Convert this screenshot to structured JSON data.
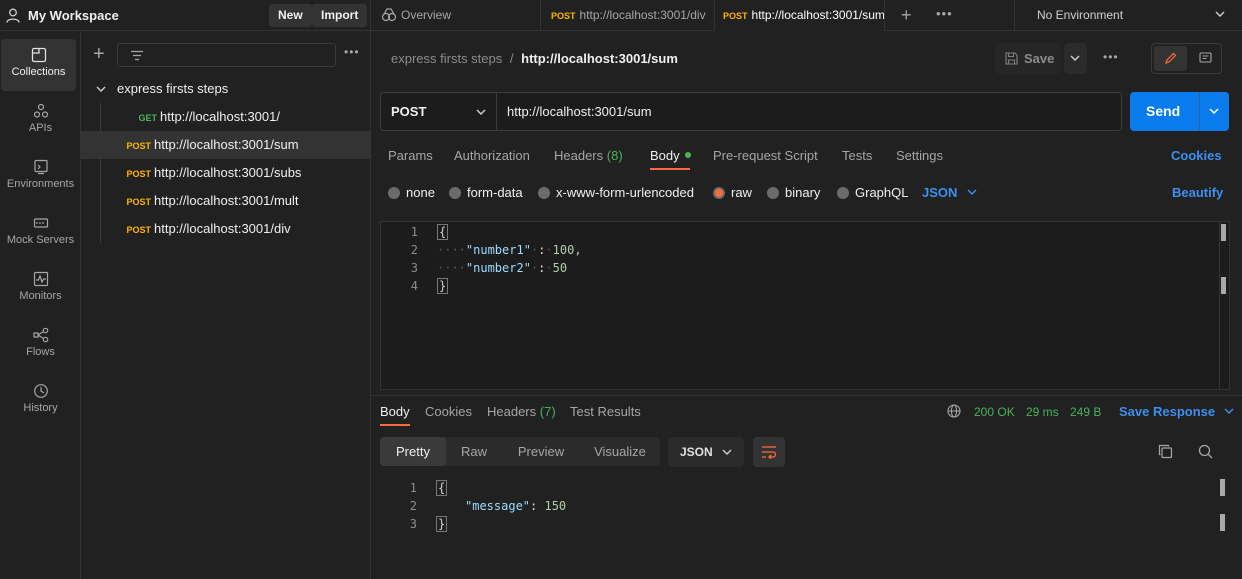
{
  "workspace": {
    "title": "My Workspace",
    "new_label": "New",
    "import_label": "Import"
  },
  "tabs": [
    {
      "label": "Overview"
    },
    {
      "method": "POST",
      "label": "http://localhost:3001/div"
    },
    {
      "method": "POST",
      "label": "http://localhost:3001/sum"
    }
  ],
  "environment": {
    "label": "No Environment"
  },
  "rail": [
    {
      "label": "Collections",
      "icon": "collections-icon"
    },
    {
      "label": "APIs",
      "icon": "apis-icon"
    },
    {
      "label": "Environments",
      "icon": "environments-icon"
    },
    {
      "label": "Mock Servers",
      "icon": "mock-servers-icon"
    },
    {
      "label": "Monitors",
      "icon": "monitors-icon"
    },
    {
      "label": "Flows",
      "icon": "flows-icon"
    },
    {
      "label": "History",
      "icon": "history-icon"
    }
  ],
  "collection": {
    "name": "express firsts steps",
    "requests": [
      {
        "method": "GET",
        "url": "http://localhost:3001/"
      },
      {
        "method": "POST",
        "url": "http://localhost:3001/sum"
      },
      {
        "method": "POST",
        "url": "http://localhost:3001/subs"
      },
      {
        "method": "POST",
        "url": "http://localhost:3001/mult"
      },
      {
        "method": "POST",
        "url": "http://localhost:3001/div"
      }
    ]
  },
  "breadcrumb": {
    "collection": "express firsts steps",
    "separator": "/",
    "request": "http://localhost:3001/sum"
  },
  "toolbar": {
    "save_label": "Save"
  },
  "request": {
    "method": "POST",
    "url": "http://localhost:3001/sum",
    "send_label": "Send"
  },
  "request_tabs": {
    "params": "Params",
    "authorization": "Authorization",
    "headers": "Headers",
    "headers_count": "(8)",
    "body": "Body",
    "prerequest": "Pre-request Script",
    "tests": "Tests",
    "settings": "Settings",
    "cookies": "Cookies"
  },
  "body_modes": {
    "none": "none",
    "form_data": "form-data",
    "urlencoded": "x-www-form-urlencoded",
    "raw": "raw",
    "binary": "binary",
    "graphql": "GraphQL",
    "format": "JSON",
    "beautify": "Beautify"
  },
  "request_body_lines": [
    {
      "n": "1",
      "text": "{"
    },
    {
      "n": "2",
      "key": "\"number1\"",
      "value": "100,"
    },
    {
      "n": "3",
      "key": "\"number2\"",
      "value": "50"
    },
    {
      "n": "4",
      "text": "}"
    }
  ],
  "response_tabs": {
    "body": "Body",
    "cookies": "Cookies",
    "headers": "Headers",
    "headers_count": "(7)",
    "test_results": "Test Results",
    "status": "200 OK",
    "time": "29 ms",
    "size": "249 B",
    "save_response": "Save Response"
  },
  "response_view": {
    "pretty": "Pretty",
    "raw": "Raw",
    "preview": "Preview",
    "visualize": "Visualize",
    "format": "JSON"
  },
  "response_body_lines": [
    {
      "n": "1",
      "text": "{"
    },
    {
      "n": "2",
      "key": "\"message\"",
      "value": "150"
    },
    {
      "n": "3",
      "text": "}"
    }
  ],
  "colors": {
    "accent": "#ff6c37",
    "send": "#097bed",
    "success": "#49b35b",
    "post": "#ffb400",
    "get": "#49b35b",
    "link": "#3d8ff0"
  }
}
